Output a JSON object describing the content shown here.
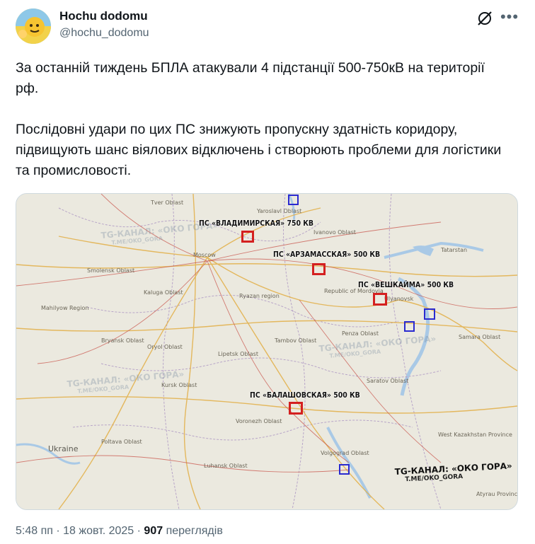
{
  "author": {
    "name": "Hochu dodomu",
    "handle": "@hochu_dodomu"
  },
  "tweet": {
    "text": "За останній тиждень БПЛА атакували 4 підстанції 500-750кВ на території рф.\n\nПослідовні удари по цих ПС знижують пропускну здатність коридору, підвищують шанс віялових відключень і створюють проблеми для логістики та промисловості."
  },
  "map": {
    "targets": [
      {
        "label": "ПС «ВЛАДИМИРСКАЯ» 750 КВ",
        "status": "attacked",
        "color": "#d42020"
      },
      {
        "label": "ПС «АРЗАМАССКАЯ» 500 КВ",
        "status": "attacked",
        "color": "#d42020"
      },
      {
        "label": "ПС «ВЕШКАЙМА» 500 КВ",
        "status": "attacked",
        "color": "#d42020"
      },
      {
        "label": "ПС «БАЛАШОВСКАЯ» 500 КВ",
        "status": "attacked",
        "color": "#d42020"
      }
    ],
    "other_marker_color": "#2a2ad0",
    "watermark": {
      "title": "TG-КАНАЛ: «ОКО ГОРА»",
      "link": "T.ME/OKO_GORA"
    },
    "places": {
      "tver": "Tver Oblast",
      "yaroslavl": "Yaroslavl Oblast",
      "ivanovo": "Ivanovo Oblast",
      "moscow": "Moscow",
      "smolensk": "Smolensk Oblast",
      "kaluga": "Kaluga Oblast",
      "ryazan": "Ryazan region",
      "mordovia": "Republic of Mordovia",
      "ulyanovsk": "Ulyanovsk",
      "tatarstan": "Tatarstan",
      "samara": "Samara Oblast",
      "penza": "Penza Oblast",
      "tambov": "Tambov Oblast",
      "lipetsk": "Lipetsk Oblast",
      "orel": "Oryol Oblast",
      "bryansk": "Bryansk Oblast",
      "mahilyow": "Mahilyow Region",
      "kursk": "Kursk Oblast",
      "voronezh": "Voronezh Oblast",
      "saratov": "Saratov Oblast",
      "poltava": "Poltava Oblast",
      "ukraine": "Ukraine",
      "luhansk": "Luhansk Oblast",
      "volgograd": "Volgograd Oblast",
      "west_kz": "West Kazakhstan Province",
      "atyrau": "Atyrau Province"
    }
  },
  "meta": {
    "time": "5:48 пп",
    "sep": "·",
    "date": "18 жовт. 2025",
    "views": "907",
    "views_label": "переглядів"
  },
  "colors": {
    "accent_red": "#d42020",
    "accent_blue": "#2a2ad0",
    "text_secondary": "#536471"
  },
  "icons": [
    "avatar-sun-icon",
    "grok-icon",
    "more-icon"
  ]
}
